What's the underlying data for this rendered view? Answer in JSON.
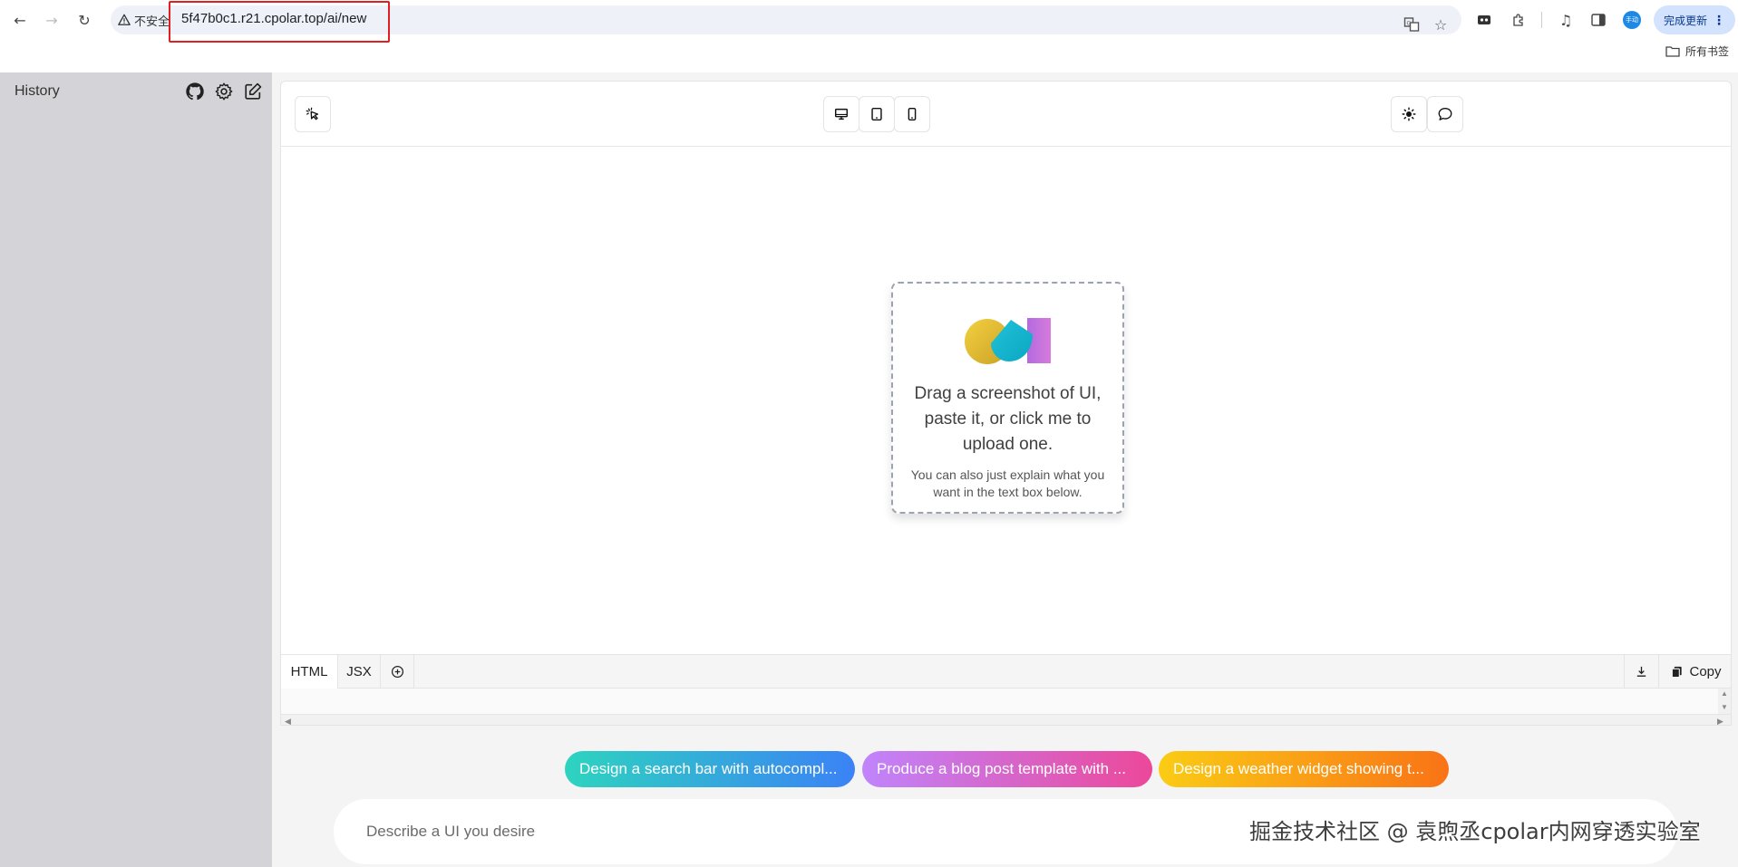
{
  "browser": {
    "security_label": "不安全",
    "url": "5f47b0c1.r21.cpolar.top/ai/new",
    "profile_label": "手动",
    "update_label": "完成更新",
    "bookmarks_label": "所有书签"
  },
  "sidebar": {
    "title": "History"
  },
  "code_tabs": {
    "html": "HTML",
    "jsx": "JSX",
    "copy": "Copy"
  },
  "dropzone": {
    "main_text": "Drag a screenshot of UI, paste it, or click me to upload one.",
    "sub_text": "You can also just explain what you want in the text box below."
  },
  "suggestions": [
    "Design a search bar with autocompl...",
    "Produce a blog post template with ...",
    "Design a weather widget showing t..."
  ],
  "prompt": {
    "placeholder": "Describe a UI you desire"
  },
  "watermark": "掘金技术社区 @ 袁煦丞cpolar内网穿透实验室",
  "colors": {
    "url_highlight": "#e02020",
    "sidebar_bg": "#d4d4d8",
    "chip1": [
      "#2dd4bf",
      "#3b82f6"
    ],
    "chip2": [
      "#c084fc",
      "#ec4899"
    ],
    "chip3": [
      "#facc15",
      "#f97316"
    ]
  }
}
